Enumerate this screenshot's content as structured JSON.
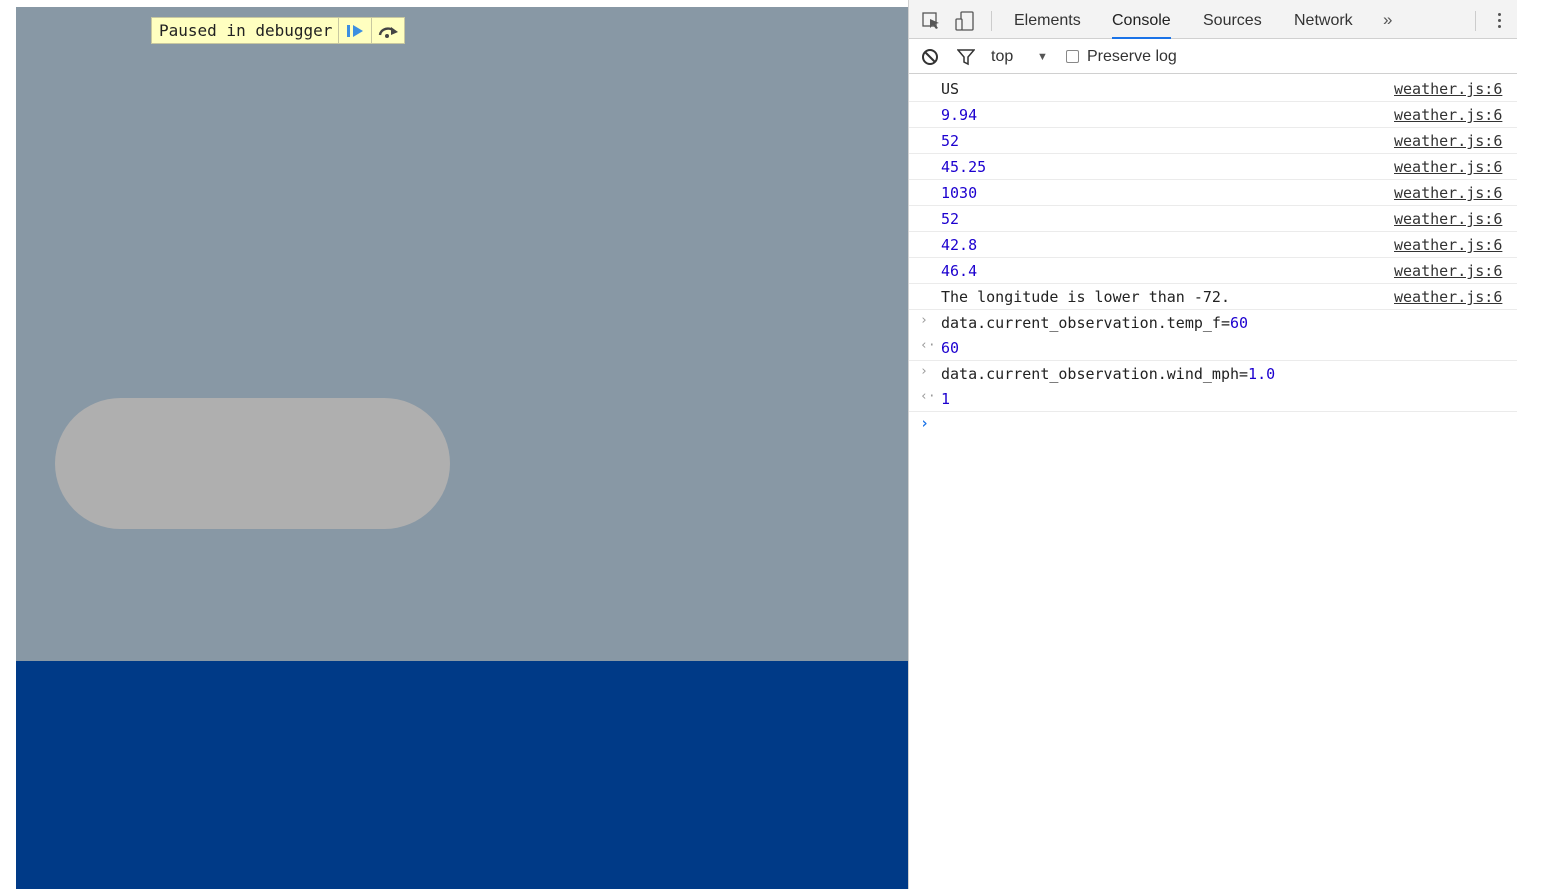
{
  "debugger_banner": {
    "text": "Paused in debugger"
  },
  "devtools": {
    "tabs": [
      {
        "label": "Elements"
      },
      {
        "label": "Console",
        "active": true
      },
      {
        "label": "Sources"
      },
      {
        "label": "Network"
      }
    ],
    "more_tabs": "»",
    "toolbar": {
      "context": "top",
      "context_arrow": "▼",
      "preserve_log_label": "Preserve log"
    },
    "console": {
      "logs": [
        {
          "text": "US",
          "source": "weather.js:6"
        },
        {
          "text": "9.94",
          "source": "weather.js:6"
        },
        {
          "text": "52",
          "source": "weather.js:6"
        },
        {
          "text": "45.25",
          "source": "weather.js:6"
        },
        {
          "text": "1030",
          "source": "weather.js:6"
        },
        {
          "text": "52",
          "source": "weather.js:6"
        },
        {
          "text": "42.8",
          "source": "weather.js:6"
        },
        {
          "text": "46.4",
          "source": "weather.js:6"
        },
        {
          "text": "The longitude is lower than -72.",
          "source": "weather.js:6"
        }
      ],
      "commands": [
        {
          "input_prefix": "data.current_observation.temp_f=",
          "input_value": "60",
          "result": "60"
        },
        {
          "input_prefix": "data.current_observation.wind_mph=",
          "input_value": "1.0",
          "result": "1"
        }
      ],
      "prompt_symbol": "›"
    }
  },
  "colors": {
    "page_background": "#8898a5",
    "ground": "#003a87",
    "pill": "#afafaf",
    "banner": "#ffffc0",
    "number_text": "#1c00cf",
    "active_tab_underline": "#1a73e8"
  }
}
